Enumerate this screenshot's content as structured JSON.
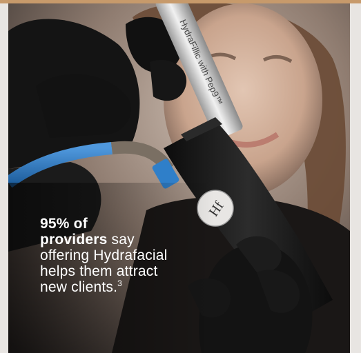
{
  "colors": {
    "top_accent": "#c79a6b",
    "caption_text": "#ffffff",
    "glove": "#141414",
    "handpiece_body": "#1c1c1c",
    "wand_metal": "#d4d4d4",
    "hose_blue": "#2f7fc9"
  },
  "wand_label": "HydraFillic with Pep9™",
  "device_logo": "Hf",
  "caption": {
    "line1_bold": "95% of",
    "line2_bold": "providers",
    "line2_rest": " say",
    "line3": "offering Hydrafacial",
    "line4": "helps them attract",
    "line5": "new clients.",
    "footnote": "3"
  }
}
